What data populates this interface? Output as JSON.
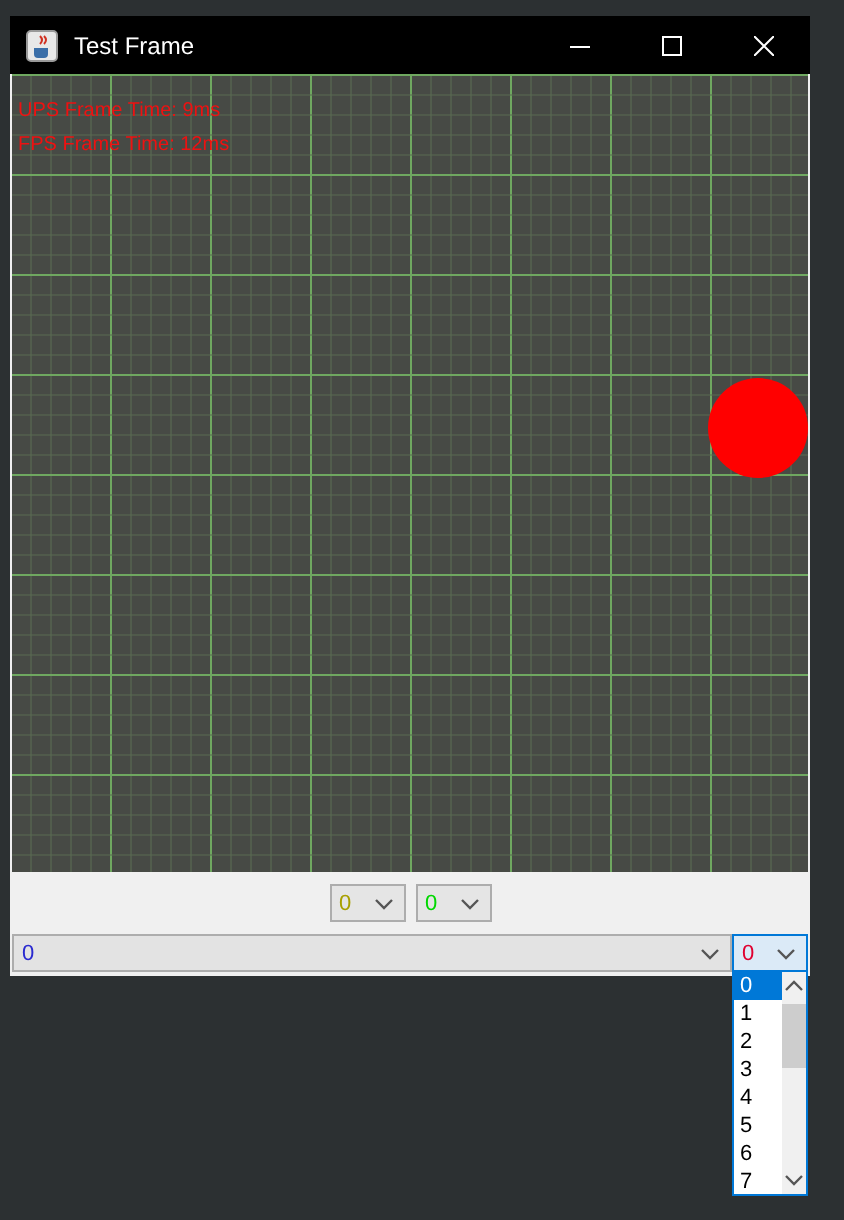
{
  "window": {
    "title": "Test Frame"
  },
  "canvas": {
    "stats": [
      "UPS Frame Time: 9ms",
      "FPS Frame Time: 12ms"
    ]
  },
  "top_combos": [
    {
      "value": "0",
      "color": "#a8a000"
    },
    {
      "value": "0",
      "color": "#00d800"
    }
  ],
  "wide_combo": {
    "value": "0",
    "color": "#2a2ad0"
  },
  "open_combo": {
    "value": "0",
    "color": "#e00030",
    "expanded": true,
    "options": [
      {
        "label": "0",
        "selected": true
      },
      {
        "label": "1",
        "selected": false
      },
      {
        "label": "2",
        "selected": false
      },
      {
        "label": "3",
        "selected": false
      },
      {
        "label": "4",
        "selected": false
      },
      {
        "label": "5",
        "selected": false
      },
      {
        "label": "6",
        "selected": false
      },
      {
        "label": "7",
        "selected": false
      }
    ]
  }
}
